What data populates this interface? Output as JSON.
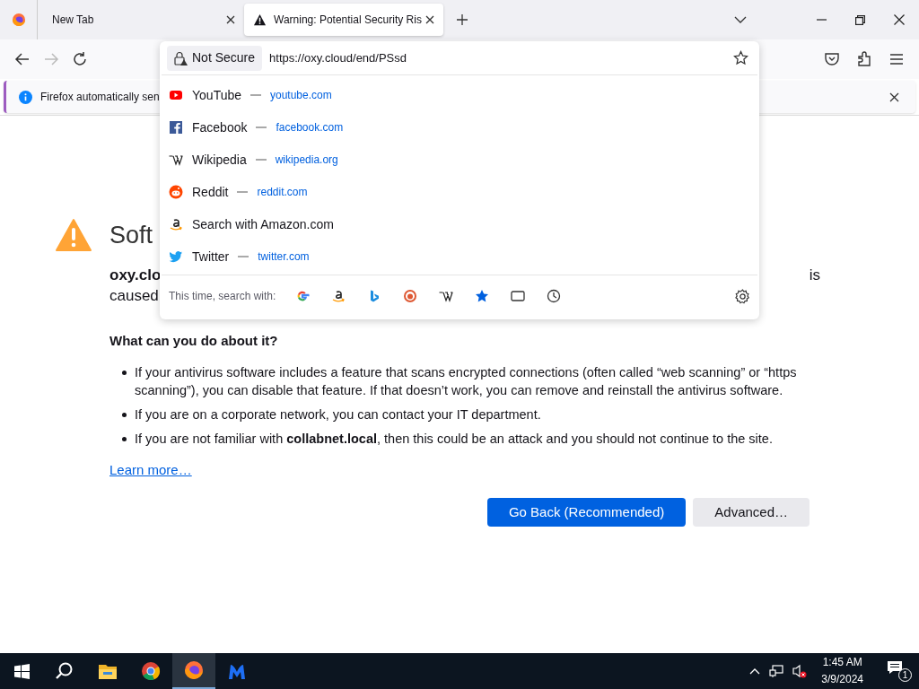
{
  "tabs": [
    {
      "kind": "newtab",
      "label": "New Tab",
      "selected": false
    },
    {
      "kind": "warning",
      "label": "Warning: Potential Security Ris",
      "selected": true
    }
  ],
  "url_bar": {
    "security_label": "Not Secure",
    "url": "https://oxy.cloud/end/PSsd"
  },
  "notification": {
    "text": "Firefox automatically sen"
  },
  "suggestions": [
    {
      "kind": "youtube",
      "title": "YouTube",
      "url": "youtube.com"
    },
    {
      "kind": "facebook",
      "title": "Facebook",
      "url": "facebook.com"
    },
    {
      "kind": "wikipedia",
      "title": "Wikipedia",
      "url": "wikipedia.org"
    },
    {
      "kind": "reddit",
      "title": "Reddit",
      "url": "reddit.com"
    },
    {
      "kind": "amazon",
      "title": "Search with Amazon.com"
    },
    {
      "kind": "twitter",
      "title": "Twitter",
      "url": "twitter.com"
    }
  ],
  "search_with": {
    "label": "This time, search with:",
    "engines": [
      {
        "kind": "google"
      },
      {
        "kind": "amazon"
      },
      {
        "kind": "bing"
      },
      {
        "kind": "duckduckgo"
      },
      {
        "kind": "wikipedia"
      },
      {
        "kind": "bookmarks"
      },
      {
        "kind": "tabs"
      },
      {
        "kind": "history"
      }
    ]
  },
  "page": {
    "heading": "Soft",
    "host": "oxy.clo",
    "line_2": "caused",
    "line_1_end": "is",
    "subheading": "What can you do about it?",
    "bullets": [
      "If your antivirus software includes a feature that scans encrypted connections (often called “web scanning” or “https scanning”), you can disable that feature. If that doesn’t work, you can remove and reinstall the antivirus software.",
      "If you are on a corporate network, you can contact your IT department.",
      "If you are not familiar with **collabnet.local**, then this could be an attack and you should not continue to the site."
    ],
    "link": "Learn more…",
    "primary_button": "Go Back (Recommended)",
    "secondary_button": "Advanced…"
  },
  "taskbar": {
    "apps": [
      {
        "kind": "files",
        "selected": false
      },
      {
        "kind": "chrome",
        "selected": false
      },
      {
        "kind": "firefox",
        "selected": true
      },
      {
        "kind": "malwarebytes",
        "selected": false
      }
    ],
    "time": "1:45 AM",
    "date": "3/9/2024",
    "notifications": "1"
  }
}
